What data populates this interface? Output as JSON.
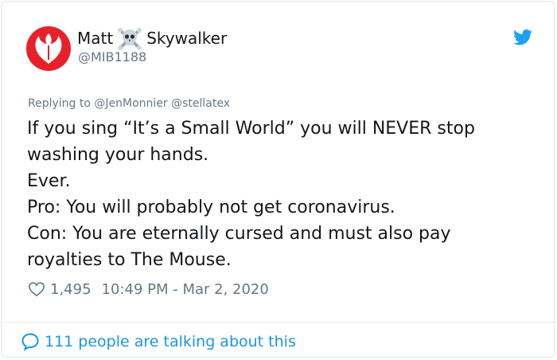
{
  "author": {
    "name_first": "Matt",
    "name_last": "Skywalker",
    "handle": "@MIB1188",
    "name_emoji": "skull-and-crossbones-icon",
    "avatar_icon": "rebel-alliance-icon"
  },
  "reply": {
    "prefix": "Replying to",
    "mentions": "@JenMonnier @stellatex"
  },
  "tweet": {
    "lines": [
      "If you sing “It’s a Small World” you will NEVER stop",
      "washing your hands.",
      "Ever.",
      "Pro: You will probably not get coronavirus.",
      "Con: You are eternally cursed and must also pay",
      "royalties to The Mouse."
    ]
  },
  "meta": {
    "likes": "1,495",
    "timestamp": "10:49 PM - Mar 2, 2020"
  },
  "footer": {
    "talking": "111 people are talking about this"
  },
  "colors": {
    "avatar_red": "#e8202a",
    "twitter_blue": "#1da1f2",
    "link_blue": "#1b95e0",
    "muted": "#657786"
  }
}
